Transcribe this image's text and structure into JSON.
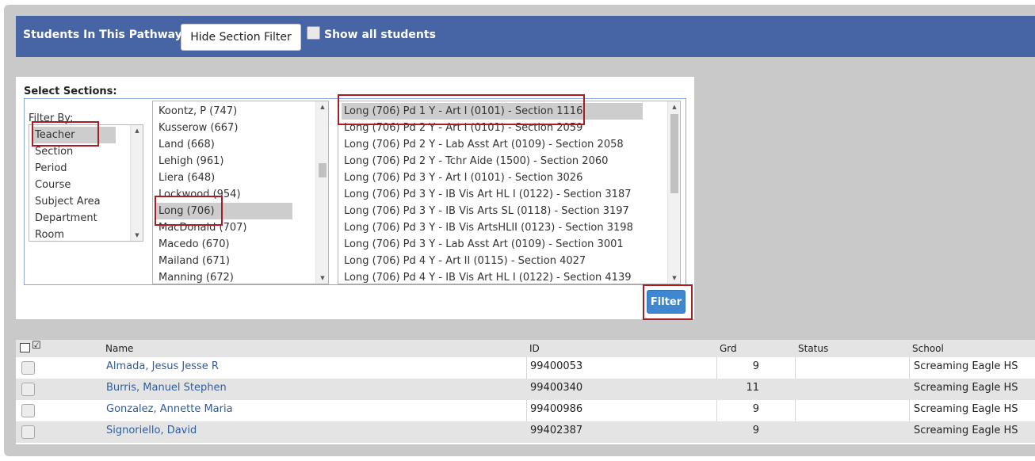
{
  "header": {
    "title": "Students In This Pathway",
    "hide_button": "Hide Section Filter",
    "show_all_label": "Show all students"
  },
  "filter_panel": {
    "select_sections_label": "Select Sections:",
    "filter_by_label": "Filter By:",
    "filter_by_options": [
      "Teacher",
      "Section",
      "Period",
      "Course",
      "Subject Area",
      "Department",
      "Room"
    ],
    "filter_by_selected": "Teacher",
    "teachers": [
      "Koontz, P (747)",
      "Kusserow (667)",
      "Land (668)",
      "Lehigh (961)",
      "Liera (648)",
      "Lockwood (954)",
      "Long (706)",
      "MacDonald (707)",
      "Macedo (670)",
      "Mailand (671)",
      "Manning (672)"
    ],
    "teacher_selected": "Long (706)",
    "sections": [
      "Long (706) Pd 1 Y - Art I (0101) - Section 1116",
      "Long (706) Pd 2 Y - Art I (0101) - Section 2059",
      "Long (706) Pd 2 Y - Lab Asst Art (0109) - Section 2058",
      "Long (706) Pd 2 Y - Tchr Aide (1500) - Section 2060",
      "Long (706) Pd 3 Y - Art I (0101) - Section 3026",
      "Long (706) Pd 3 Y - IB Vis Art HL I (0122) - Section 3187",
      "Long (706) Pd 3 Y - IB Vis Arts SL (0118) - Section 3197",
      "Long (706) Pd 3 Y - IB Vis ArtsHLII (0123) - Section 3198",
      "Long (706) Pd 3 Y - Lab Asst Art (0109) - Section 3001",
      "Long (706) Pd 4 Y - Art II (0115) - Section 4027",
      "Long (706) Pd 4 Y - IB Vis Art HL I (0122) - Section 4139"
    ],
    "section_selected": "Long (706) Pd 1 Y - Art I (0101) - Section 1116",
    "filter_button": "Filter"
  },
  "students_table": {
    "columns": [
      "Name",
      "ID",
      "Grd",
      "Status",
      "School"
    ],
    "rows": [
      {
        "name": "Almada, Jesus Jesse R",
        "id": "99400053",
        "grd": "9",
        "status": "",
        "school": "Screaming Eagle HS"
      },
      {
        "name": "Burris, Manuel Stephen",
        "id": "99400340",
        "grd": "11",
        "status": "",
        "school": "Screaming Eagle HS"
      },
      {
        "name": "Gonzalez, Annette Maria",
        "id": "99400986",
        "grd": "9",
        "status": "",
        "school": "Screaming Eagle HS"
      },
      {
        "name": "Signoriello, David",
        "id": "99402387",
        "grd": "9",
        "status": "",
        "school": "Screaming Eagle HS"
      }
    ]
  },
  "colors": {
    "header_bar": "#4765a4",
    "highlight_box": "#a71d20",
    "filter_button": "#3f87d0",
    "link": "#2e5d9f"
  }
}
